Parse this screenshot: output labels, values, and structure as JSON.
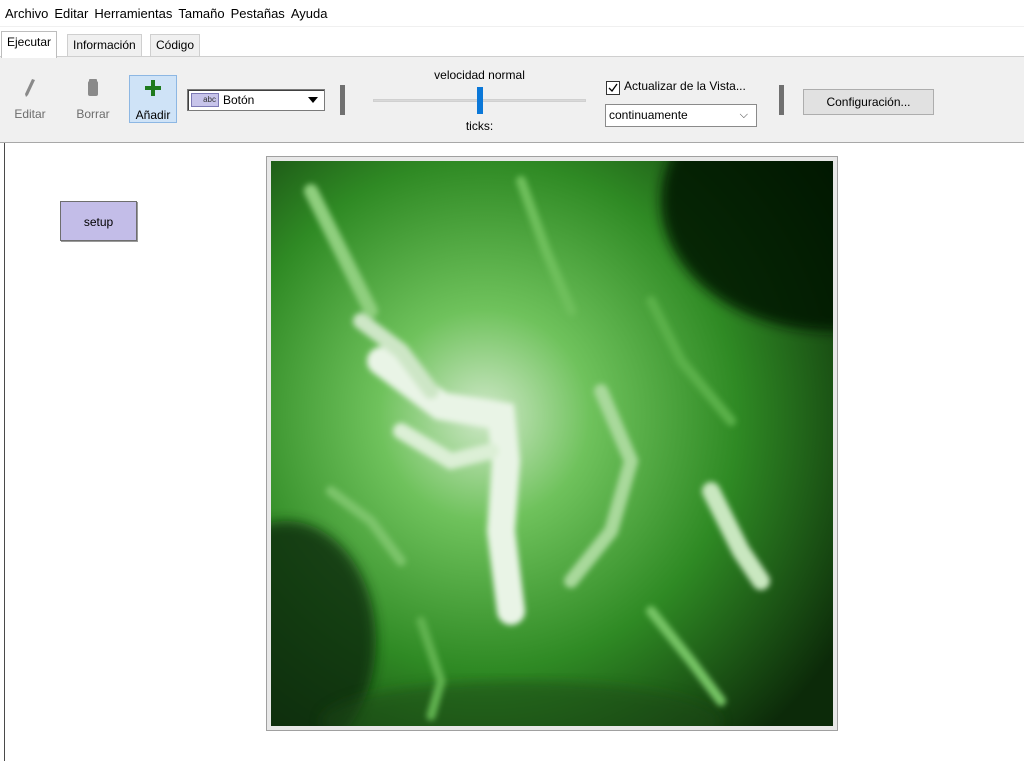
{
  "menubar": {
    "items": [
      "Archivo",
      "Editar",
      "Herramientas",
      "Tamaño",
      "Pestañas",
      "Ayuda"
    ]
  },
  "tabs": [
    {
      "label": "Ejecutar",
      "active": true
    },
    {
      "label": "Información",
      "active": false
    },
    {
      "label": "Código",
      "active": false
    }
  ],
  "toolbar": {
    "edit_label": "Editar",
    "delete_label": "Borrar",
    "add_label": "Añadir",
    "widget_type": "Botón",
    "widget_icon_text": "abc",
    "speed_label": "velocidad normal",
    "speed_value": 0.5,
    "ticks_label": "ticks:",
    "view_update_label": "Actualizar de la Vista...",
    "view_update_checked": true,
    "update_mode": "continuamente",
    "settings_label": "Configuración..."
  },
  "interface": {
    "setup_label": "setup",
    "view_description_color": "#3a9a2c"
  },
  "colors": {
    "toolbar_bg": "#f0f0f0",
    "add_button_bg": "#cfe3f7",
    "setup_button_bg": "#c3bde8",
    "slider_thumb": "#0b78d8",
    "terrain_dark": "#0a1f08",
    "terrain_mid": "#3a9a2c",
    "terrain_light": "#e6f2e2"
  }
}
